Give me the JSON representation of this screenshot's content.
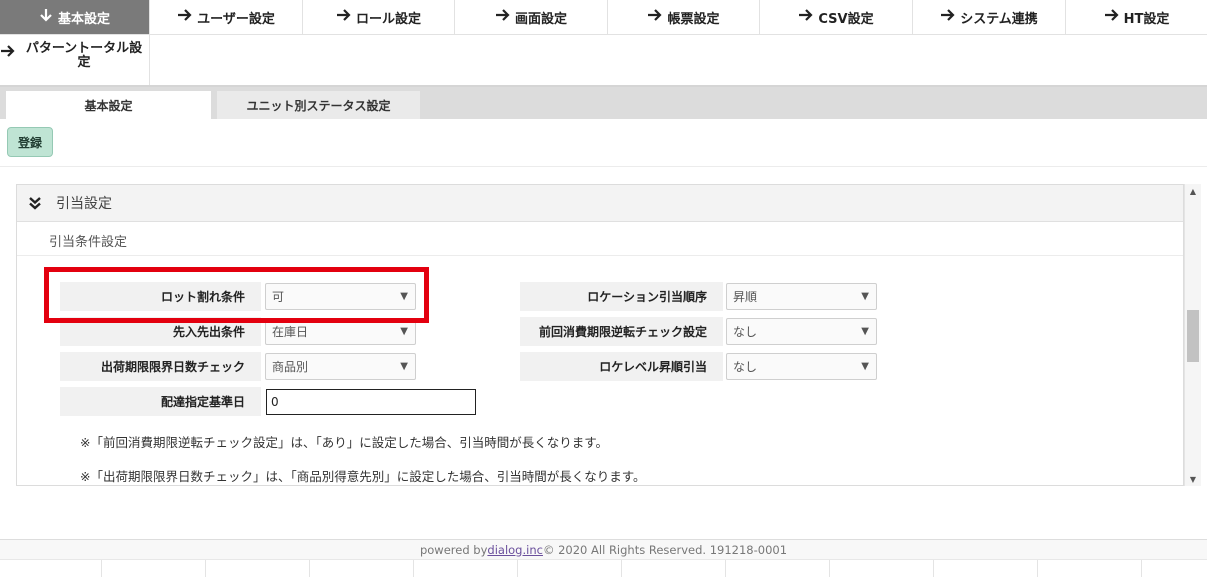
{
  "menu": {
    "arrow_right": "➔",
    "arrow_down": "🡓",
    "items": [
      {
        "label": "基本設定",
        "active": true
      },
      {
        "label": "ユーザー設定"
      },
      {
        "label": "ロール設定"
      },
      {
        "label": "画面設定"
      },
      {
        "label": "帳票設定"
      },
      {
        "label": "CSV設定"
      },
      {
        "label": "システム連携"
      },
      {
        "label": "HT設定"
      },
      {
        "label": "パターントータル設定"
      }
    ]
  },
  "tabs": [
    {
      "label": "基本設定",
      "active": true
    },
    {
      "label": "ユニット別ステータス設定"
    }
  ],
  "toolbar": {
    "register_label": "登録"
  },
  "panel": {
    "title": "引当設定",
    "subtitle": "引当条件設定",
    "left_fields": [
      {
        "label": "ロット割れ条件",
        "value": "可"
      },
      {
        "label": "先入先出条件",
        "value": "在庫日"
      },
      {
        "label": "出荷期限限界日数チェック",
        "value": "商品別"
      },
      {
        "label": "配達指定基準日",
        "value": "0"
      }
    ],
    "right_fields": [
      {
        "label": "ロケーション引当順序",
        "value": "昇順"
      },
      {
        "label": "前回消費期限逆転チェック設定",
        "value": "なし"
      },
      {
        "label": "ロケレベル昇順引当",
        "value": "なし"
      }
    ],
    "notes": [
      "※「前回消費期限逆転チェック設定」は、「あり」に設定した場合、引当時間が長くなります。",
      "※「出荷期限限界日数チェック」は、「商品別得意先別」に設定した場合、引当時間が長くなります。"
    ]
  },
  "icons": {
    "select_caret": "▼",
    "scroll_up": "▲",
    "scroll_down": "▼"
  },
  "footer": {
    "prefix": "powered by ",
    "link": "dialog.inc",
    "suffix": " © 2020 All Rights Reserved. 191218-0001"
  },
  "colors": {
    "highlight": "#e3000f",
    "active_menu": "#7a7a7a",
    "register_button": "#bfe4d4"
  }
}
